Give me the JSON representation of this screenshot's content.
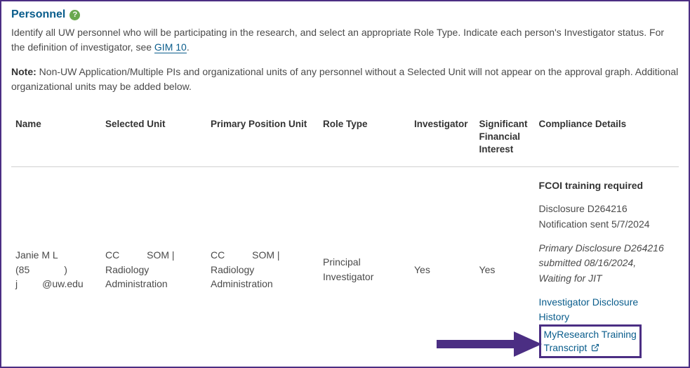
{
  "section": {
    "title": "Personnel",
    "intro_pre": "Identify all UW personnel who will be participating in the research, and select an appropriate Role Type. Indicate each person's Investigator status. For the definition of investigator, see ",
    "intro_link": "GIM 10",
    "intro_post": ".",
    "note_label": "Note:",
    "note_body": " Non-UW Application/Multiple PIs and organizational units of any personnel without a Selected Unit will not appear on the approval graph. Additional organizational units may be added below."
  },
  "columns": {
    "name": "Name",
    "selected_unit": "Selected Unit",
    "primary_unit": "Primary Position Unit",
    "role_type": "Role Type",
    "investigator": "Investigator",
    "sfi": "Significant Financial Interest",
    "compliance": "Compliance Details"
  },
  "rows": [
    {
      "name": {
        "line1_pre": "Janie M L",
        "line2_pre": "(85",
        "line2_post": ")",
        "line3_pre": "j",
        "line3_post": "@uw.edu"
      },
      "selected_unit": {
        "line1_pre": "CC",
        "line1_post": " SOM |",
        "line2": "Radiology",
        "line3": "Administration"
      },
      "primary_unit": {
        "line1_pre": "CC",
        "line1_post": " SOM |",
        "line2": "Radiology",
        "line3": "Administration"
      },
      "role_type": "Principal Investigator",
      "investigator": "Yes",
      "sfi": "Yes",
      "compliance": {
        "required": "FCOI training required",
        "disc1_l1": "Disclosure D264216",
        "disc1_l2": "Notification sent 5/7/2024",
        "disc2_l1": "Primary Disclosure D264216",
        "disc2_l2": "submitted 08/16/2024,",
        "disc2_l3": "Waiting for JIT",
        "link1_l1": "Investigator Disclosure",
        "link1_l2": "History",
        "link2_l1": "MyResearch Training",
        "link2_l2": "Transcript"
      }
    }
  ],
  "icons": {
    "help": "?"
  }
}
